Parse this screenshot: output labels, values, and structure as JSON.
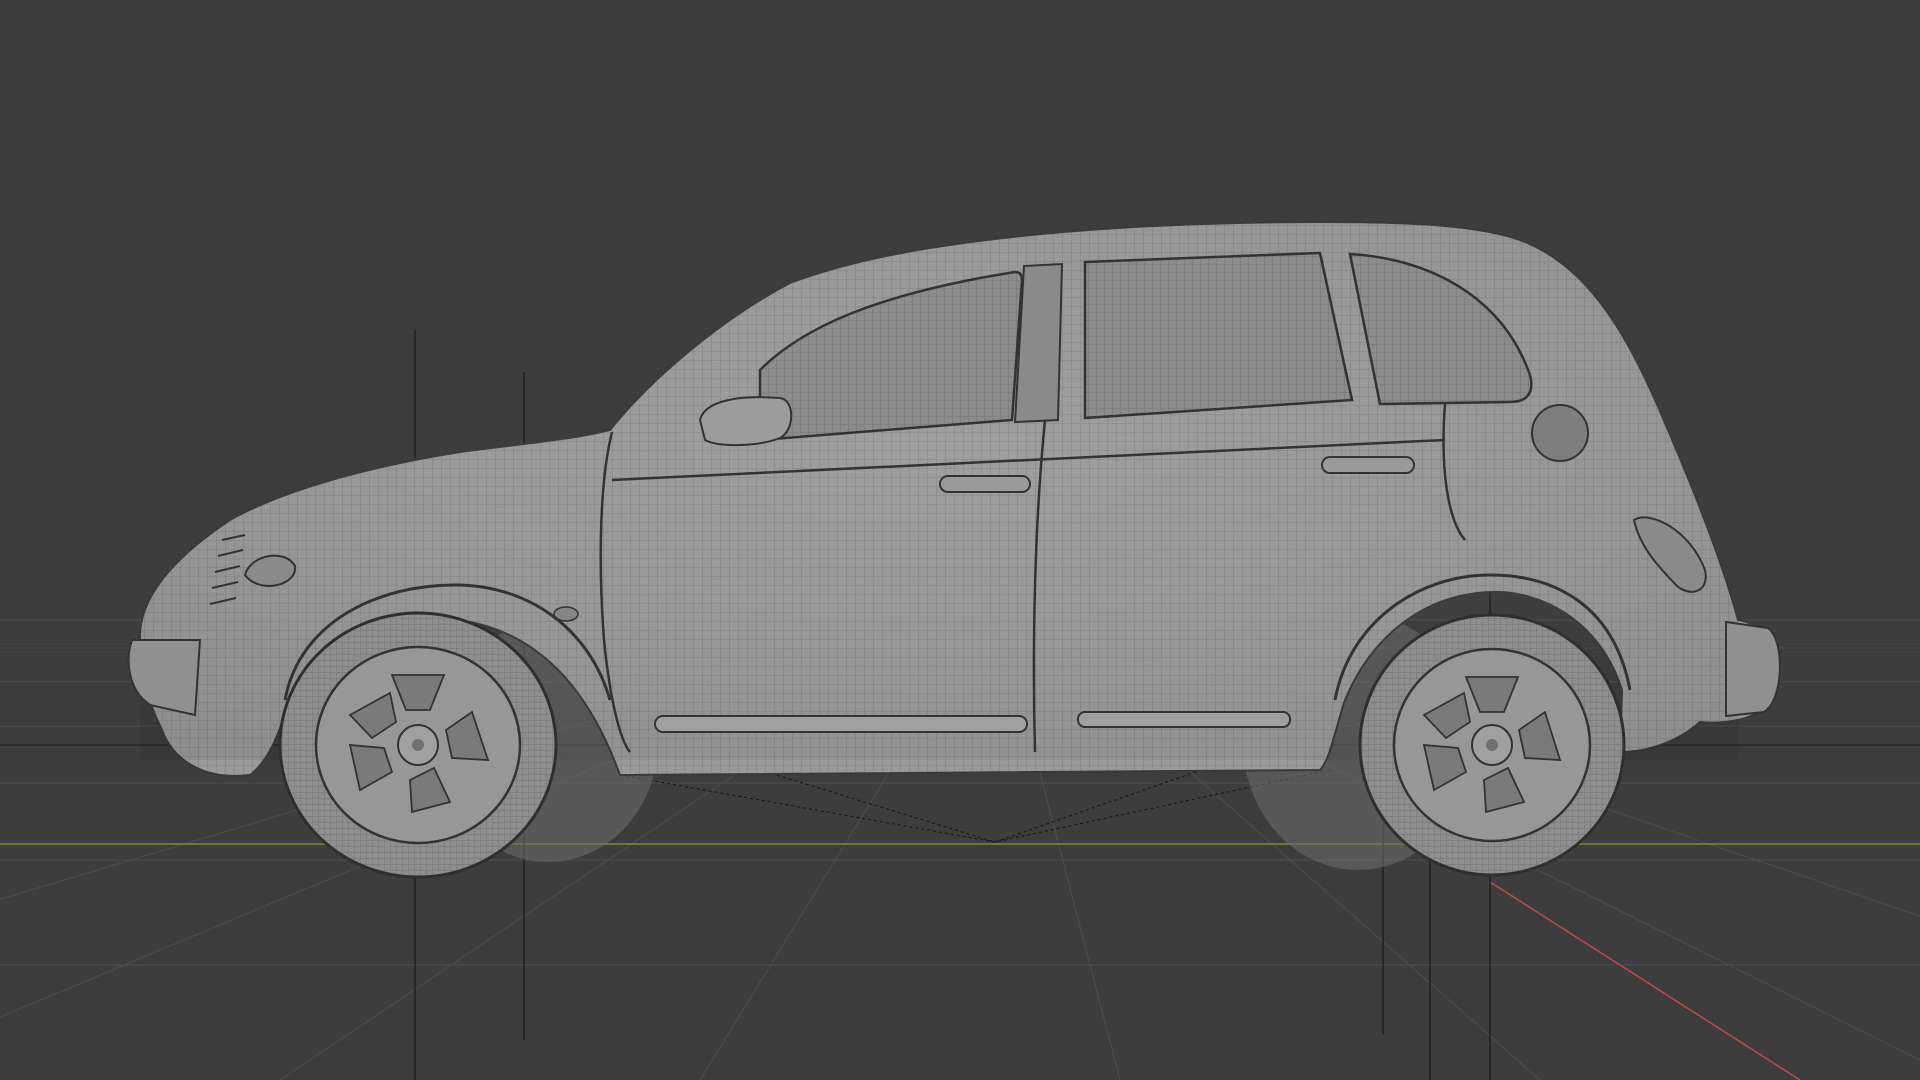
{
  "viewport": {
    "background_color": "#3d3d3d",
    "grid_color": "#4a4a4a",
    "x_axis_color": "#b84a4a",
    "y_axis_color": "#7f8a3a",
    "object": "car-model",
    "object_shading": "solid-wireframe",
    "mesh_color": "#9a9a9a",
    "wire_color": "#6c6c6c"
  }
}
